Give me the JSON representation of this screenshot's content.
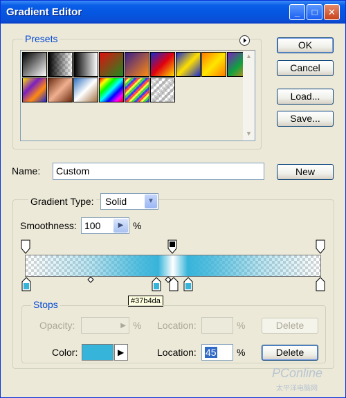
{
  "window": {
    "title": "Gradient Editor"
  },
  "titlebar_buttons": {
    "minimize": "_",
    "maximize": "□",
    "close": "✕"
  },
  "presets": {
    "legend": "Presets",
    "menu_icon": "circle-arrow-right-icon",
    "swatches": [
      {
        "name": "black-white",
        "bg": "linear-gradient(135deg,#000 0%,#fff 100%)"
      },
      {
        "name": "foreground-transparent",
        "bg": "linear-gradient(90deg,#000 0%,rgba(0,0,0,0) 100%)",
        "checker": true
      },
      {
        "name": "black-white-2",
        "bg": "linear-gradient(90deg,#000 0%,#fff 100%)"
      },
      {
        "name": "red-green",
        "bg": "linear-gradient(135deg,#e01010 0%,#1f8a1f 100%)"
      },
      {
        "name": "violet-orange",
        "bg": "linear-gradient(135deg,#3a1f8a 0%,#ff8a10 100%)"
      },
      {
        "name": "blue-red-yellow",
        "bg": "linear-gradient(135deg,#1a2ad0 0%,#e00010 50%,#ffe000 100%)"
      },
      {
        "name": "blue-yellow-blue",
        "bg": "linear-gradient(135deg,#1a2ad0 0%,#ffe000 50%,#1a2ad0 100%)"
      },
      {
        "name": "orange-yellow-orange",
        "bg": "linear-gradient(135deg,#ff7a00 0%,#ffe600 50%,#ff7a00 100%)"
      },
      {
        "name": "violet-green-orange",
        "bg": "linear-gradient(135deg,#7a20c0 0%,#10a040 50%,#ff8a10 100%)"
      },
      {
        "name": "yellow-violet-orange-blue",
        "bg": "linear-gradient(135deg,#ffe000 0%,#7a20c0 35%,#ff8a10 65%,#1a2ad0 100%)"
      },
      {
        "name": "copper",
        "bg": "linear-gradient(135deg,#6a2a10 0%,#f0b090 50%,#6a2a10 100%)"
      },
      {
        "name": "chrome",
        "bg": "linear-gradient(135deg,#3070c0 0%,#ffffff 50%,#a07040 100%)"
      },
      {
        "name": "spectrum",
        "bg": "linear-gradient(135deg,#ff0000,#ffff00,#00ff00,#00ffff,#0000ff,#ff00ff,#ff0000)"
      },
      {
        "name": "transparent-rainbow",
        "bg": "repeating-linear-gradient(135deg,rgba(255,0,0,.7) 0 3px,rgba(255,255,0,.7) 3px 6px,rgba(0,200,0,.7) 6px 9px,rgba(0,0,255,.7) 9px 12px)",
        "checker": true
      },
      {
        "name": "transparent-stripes",
        "bg": "repeating-linear-gradient(135deg,rgba(120,120,120,.4) 0 4px,rgba(255,255,255,0) 4px 8px)",
        "checker": true
      }
    ]
  },
  "buttons": {
    "ok": "OK",
    "cancel": "Cancel",
    "load": "Load...",
    "save": "Save...",
    "new": "New",
    "delete": "Delete"
  },
  "name_field": {
    "label": "Name:",
    "value": "Custom"
  },
  "gradient": {
    "type_label": "Gradient Type:",
    "type_value": "Solid",
    "smoothness_label": "Smoothness:",
    "smoothness_value": "100",
    "percent": "%",
    "color": "#37b4da"
  },
  "stops": {
    "legend": "Stops",
    "opacity_label": "Opacity:",
    "location_label": "Location:",
    "color_label": "Color:",
    "location_value": "45",
    "percent": "%",
    "tooltip": "#37b4da"
  },
  "watermark": {
    "brand": "PConline",
    "sub": "太平洋电脑网"
  }
}
